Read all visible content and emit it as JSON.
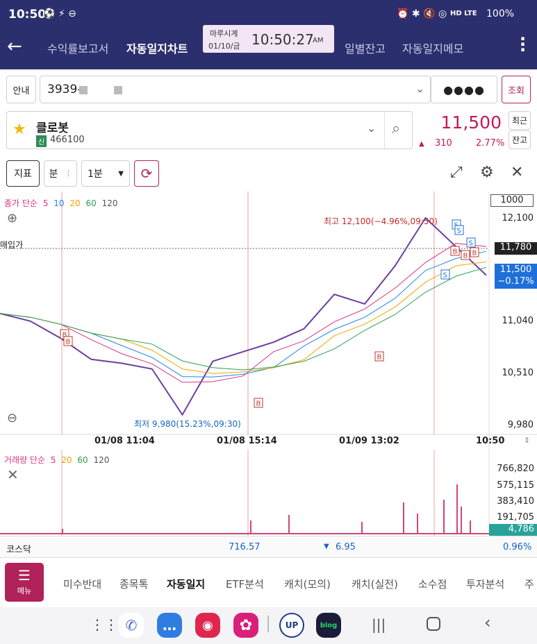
{
  "status": {
    "time": "10:50",
    "signal": "HD LTE",
    "battery": "100%"
  },
  "nav": {
    "tabs": [
      {
        "label": "수익률보고서"
      },
      {
        "label": "자동일지차트"
      },
      {
        "label": "일별잔고"
      },
      {
        "label": "자동일지메모"
      }
    ]
  },
  "clock": {
    "title": "마루시계",
    "date": "01/10/금",
    "time": "10:50:27",
    "ampm": "AM"
  },
  "account": {
    "guide_label": "안내",
    "number": "3939-",
    "password_mask": "●●●●",
    "query_label": "조회"
  },
  "stock": {
    "name": "클로봇",
    "badge": "신",
    "code": "466100",
    "price": "11,500",
    "change": "310",
    "change_pct": "2.77%",
    "recent_label": "최근",
    "balance_label": "잔고"
  },
  "toolbar": {
    "indicator_label": "지표",
    "period_label": "분",
    "interval": "1분"
  },
  "chart": {
    "ma_legend": {
      "prefix": "종가 단순",
      "items": [
        {
          "label": "5",
          "color": "#d63384"
        },
        {
          "label": "10",
          "color": "#1e88e5"
        },
        {
          "label": "20",
          "color": "#f0a500"
        },
        {
          "label": "60",
          "color": "#2e9e4f"
        },
        {
          "label": "120",
          "color": "#555555"
        }
      ]
    },
    "count_box": "1000",
    "buy_price_label": "매입가",
    "high_label": "최고 12,100(−4.96%,09:50)",
    "low_label": "최저 9,980(15.23%,09:30)",
    "y_ticks": [
      "12,100",
      "11,040",
      "10,510",
      "9,980"
    ],
    "buy_price_tag": "11,780",
    "current_tag": {
      "price": "11,500",
      "pct": "−0.17%"
    },
    "x_ticks": [
      "01/08 11:04",
      "01/08 15:14",
      "01/09 13:02",
      "10:50"
    ]
  },
  "volume": {
    "legend": {
      "prefix": "거래량 단순",
      "items": [
        {
          "label": "5",
          "color": "#d63384"
        },
        {
          "label": "20",
          "color": "#f0a500"
        },
        {
          "label": "60",
          "color": "#2e9e4f"
        },
        {
          "label": "120",
          "color": "#555555"
        }
      ]
    },
    "y_ticks": [
      "766,820",
      "575,115",
      "383,410",
      "191,705"
    ],
    "current_tag": "4,786"
  },
  "index": {
    "name": "코스닥",
    "value": "716.57",
    "change": "6.95",
    "pct": "0.96%"
  },
  "menu": {
    "button_label": "메뉴",
    "tabs": [
      {
        "label": "미수반대"
      },
      {
        "label": "종목톡"
      },
      {
        "label": "자동일지"
      },
      {
        "label": "ETF분석"
      },
      {
        "label": "캐치(모의)"
      },
      {
        "label": "캐치(실전)"
      },
      {
        "label": "소수점"
      },
      {
        "label": "투자분석"
      },
      {
        "label": "주"
      }
    ]
  },
  "dock": {
    "up_label": "UP",
    "blog_label": "blog"
  },
  "chart_data": {
    "type": "line",
    "title": "",
    "x": [
      "01/08 11:04",
      "01/08 15:14",
      "01/09 13:02",
      "10:50"
    ],
    "y_range": [
      9980,
      12100
    ],
    "series": [
      {
        "values": [
          11100,
          11020,
          10840,
          10620,
          10580,
          10520,
          10040,
          10600,
          10700,
          10800,
          10940,
          11300,
          11200,
          11600,
          12100,
          11800,
          11500
        ]
      }
    ],
    "y_ticks": [
      12100,
      11040,
      10510,
      9980
    ],
    "high": 12100,
    "low": 9980,
    "buy_price": 11780,
    "current": 11500
  }
}
